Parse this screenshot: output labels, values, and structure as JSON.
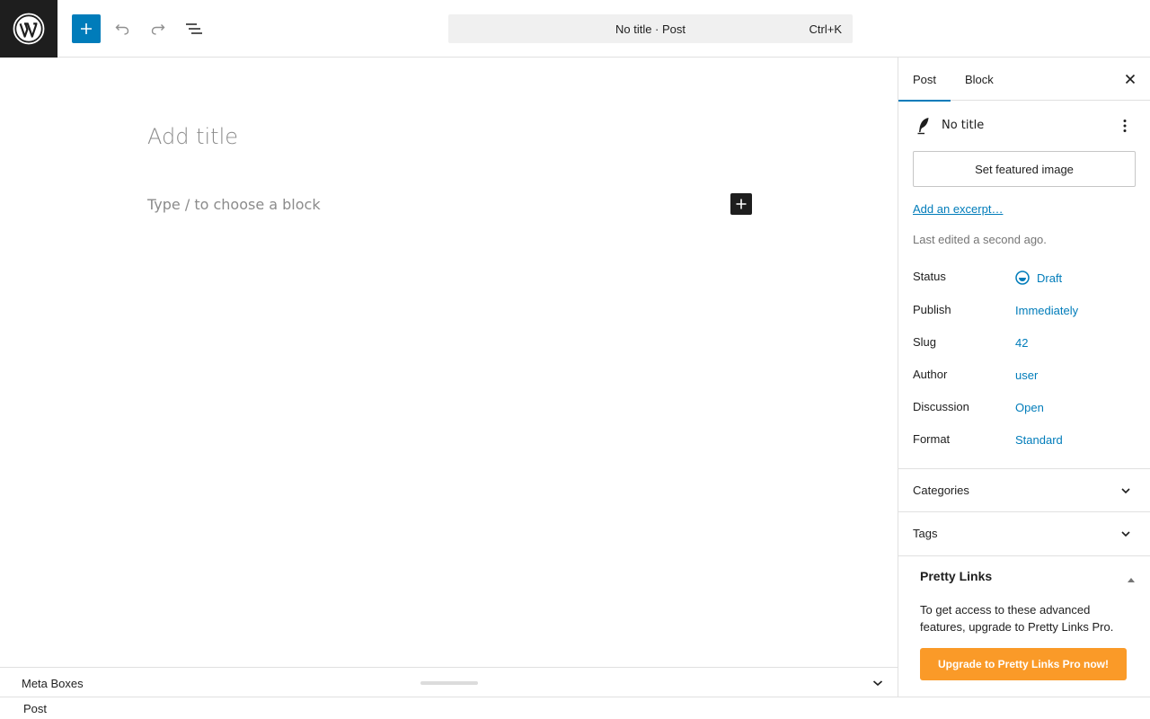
{
  "toolbar": {
    "logo_icon": "wordpress-logo-icon",
    "add_block_icon": "plus-icon",
    "undo_icon": "undo-icon",
    "redo_icon": "redo-icon",
    "document_overview_icon": "list-view-icon"
  },
  "command_bar": {
    "title": "No title · Post",
    "shortcut": "Ctrl+K"
  },
  "editor": {
    "title_placeholder": "Add title",
    "block_placeholder": "Type / to choose a block"
  },
  "meta_boxes": {
    "label": "Meta Boxes"
  },
  "footer": {
    "breadcrumb": "Post"
  },
  "sidebar": {
    "tabs": [
      {
        "label": "Post",
        "active": true
      },
      {
        "label": "Block",
        "active": false
      }
    ],
    "post_title": "No title",
    "featured_image_label": "Set featured image",
    "excerpt_link": "Add an excerpt…",
    "last_edited": "Last edited a second ago.",
    "rows": [
      {
        "label": "Status",
        "value": "Draft"
      },
      {
        "label": "Publish",
        "value": "Immediately"
      },
      {
        "label": "Slug",
        "value": "42"
      },
      {
        "label": "Author",
        "value": "user"
      },
      {
        "label": "Discussion",
        "value": "Open"
      },
      {
        "label": "Format",
        "value": "Standard"
      }
    ],
    "panels": [
      {
        "label": "Categories"
      },
      {
        "label": "Tags"
      }
    ],
    "pretty_links": {
      "title": "Pretty Links",
      "description": "To get access to these advanced features, upgrade to Pretty Links Pro.",
      "button_label": "Upgrade to Pretty Links Pro now!",
      "button_color": "#fa9a28"
    }
  },
  "colors": {
    "accent": "#007cba",
    "dark": "#1e1e1e"
  }
}
